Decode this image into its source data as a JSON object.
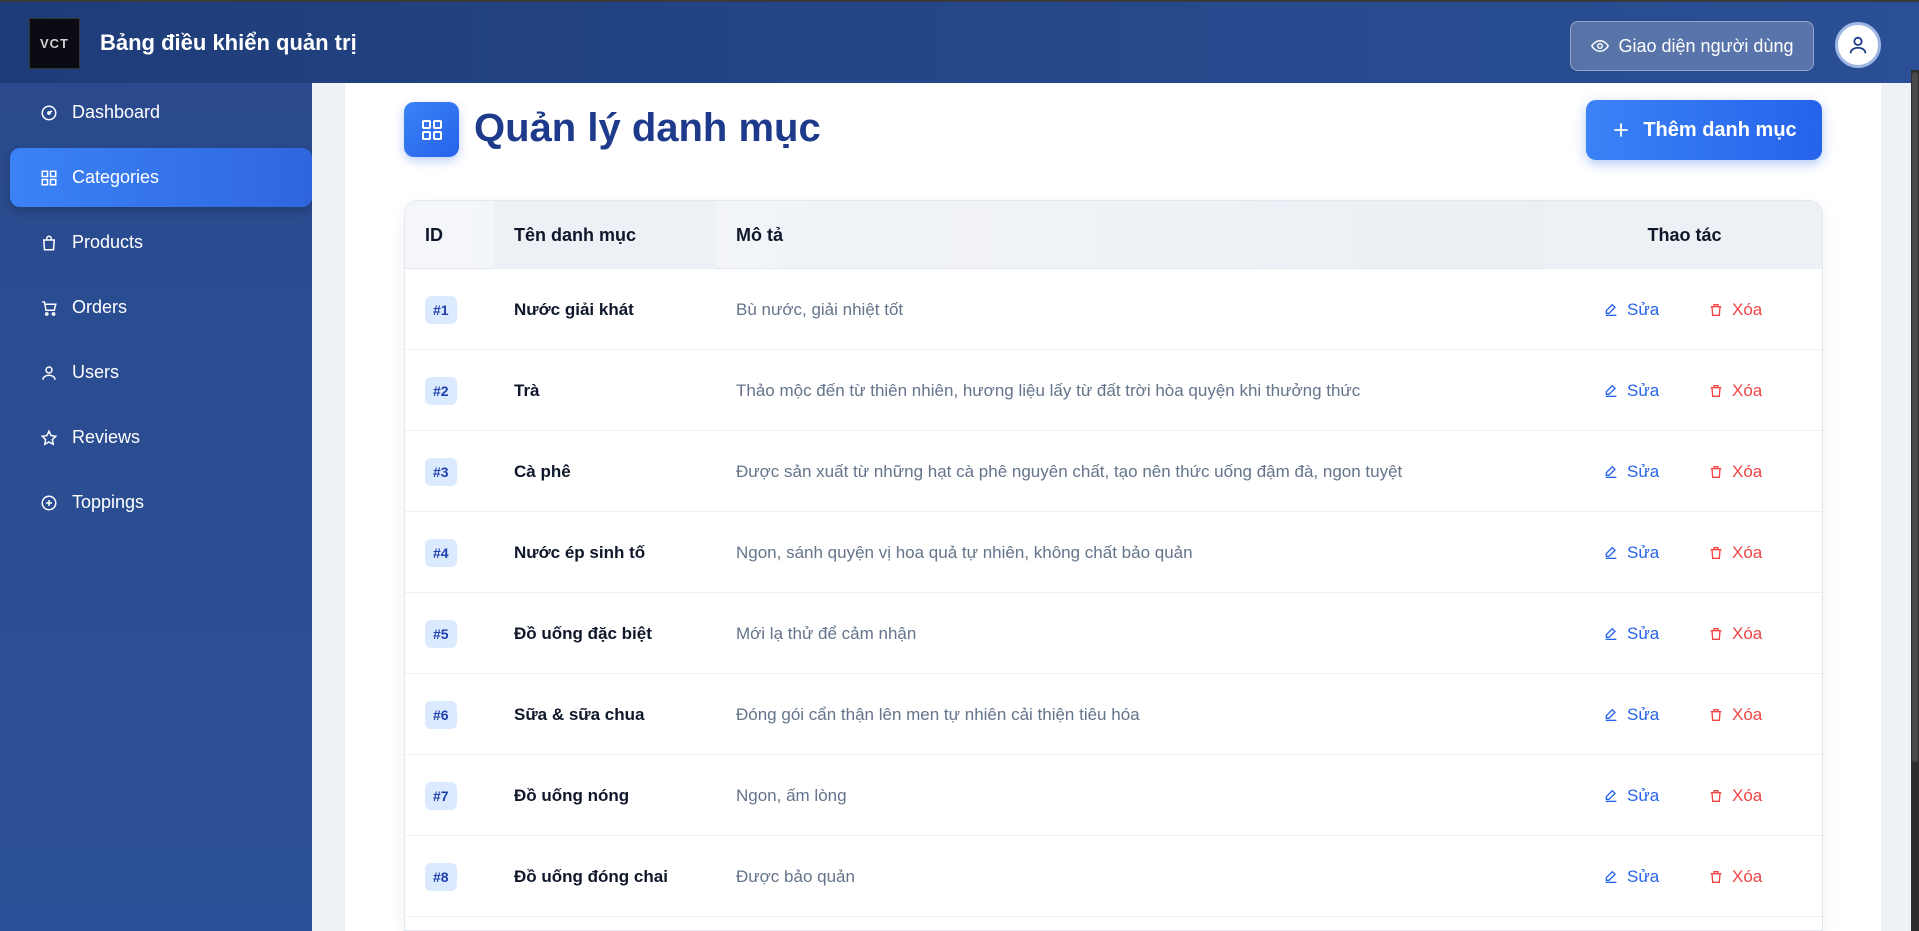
{
  "header": {
    "logo_text": "VCT",
    "title": "Bảng điều khiển quản trị",
    "user_view_label": "Giao diện người dùng"
  },
  "sidebar": {
    "items": [
      {
        "label": "Dashboard",
        "icon": "dashboard-icon",
        "active": false
      },
      {
        "label": "Categories",
        "icon": "grid-icon",
        "active": true
      },
      {
        "label": "Products",
        "icon": "shopping-bag-icon",
        "active": false
      },
      {
        "label": "Orders",
        "icon": "cart-icon",
        "active": false
      },
      {
        "label": "Users",
        "icon": "user-icon",
        "active": false
      },
      {
        "label": "Reviews",
        "icon": "star-icon",
        "active": false
      },
      {
        "label": "Toppings",
        "icon": "plus-circle-icon",
        "active": false
      }
    ]
  },
  "page": {
    "title": "Quản lý danh mục",
    "add_button_label": "Thêm danh mục"
  },
  "table": {
    "headers": {
      "id": "ID",
      "name": "Tên danh mục",
      "description": "Mô tả",
      "actions": "Thao tác"
    },
    "edit_label": "Sửa",
    "delete_label": "Xóa",
    "rows": [
      {
        "id": "#1",
        "name": "Nước giải khát",
        "description": "Bù nước, giải nhiệt tốt"
      },
      {
        "id": "#2",
        "name": "Trà",
        "description": "Thảo mộc đến từ thiên nhiên, hương liệu lấy từ đất trời hòa quyện khi thưởng thức"
      },
      {
        "id": "#3",
        "name": "Cà phê",
        "description": "Được sản xuất từ những hạt cà phê nguyên chất, tạo nên thức uống đậm đà, ngon tuyệt"
      },
      {
        "id": "#4",
        "name": "Nước ép sinh tố",
        "description": "Ngon, sánh quyện vị hoa quả tự nhiên, không chất bảo quản"
      },
      {
        "id": "#5",
        "name": "Đồ uống đặc biệt",
        "description": "Mới lạ thử để cảm nhận"
      },
      {
        "id": "#6",
        "name": "Sữa & sữa chua",
        "description": "Đóng gói cẩn thận lên men tự nhiên cải thiện tiêu hóa"
      },
      {
        "id": "#7",
        "name": "Đồ uống nóng",
        "description": "Ngon, ấm lòng"
      },
      {
        "id": "#8",
        "name": "Đồ uống đóng chai",
        "description": "Được bảo quản"
      }
    ]
  }
}
